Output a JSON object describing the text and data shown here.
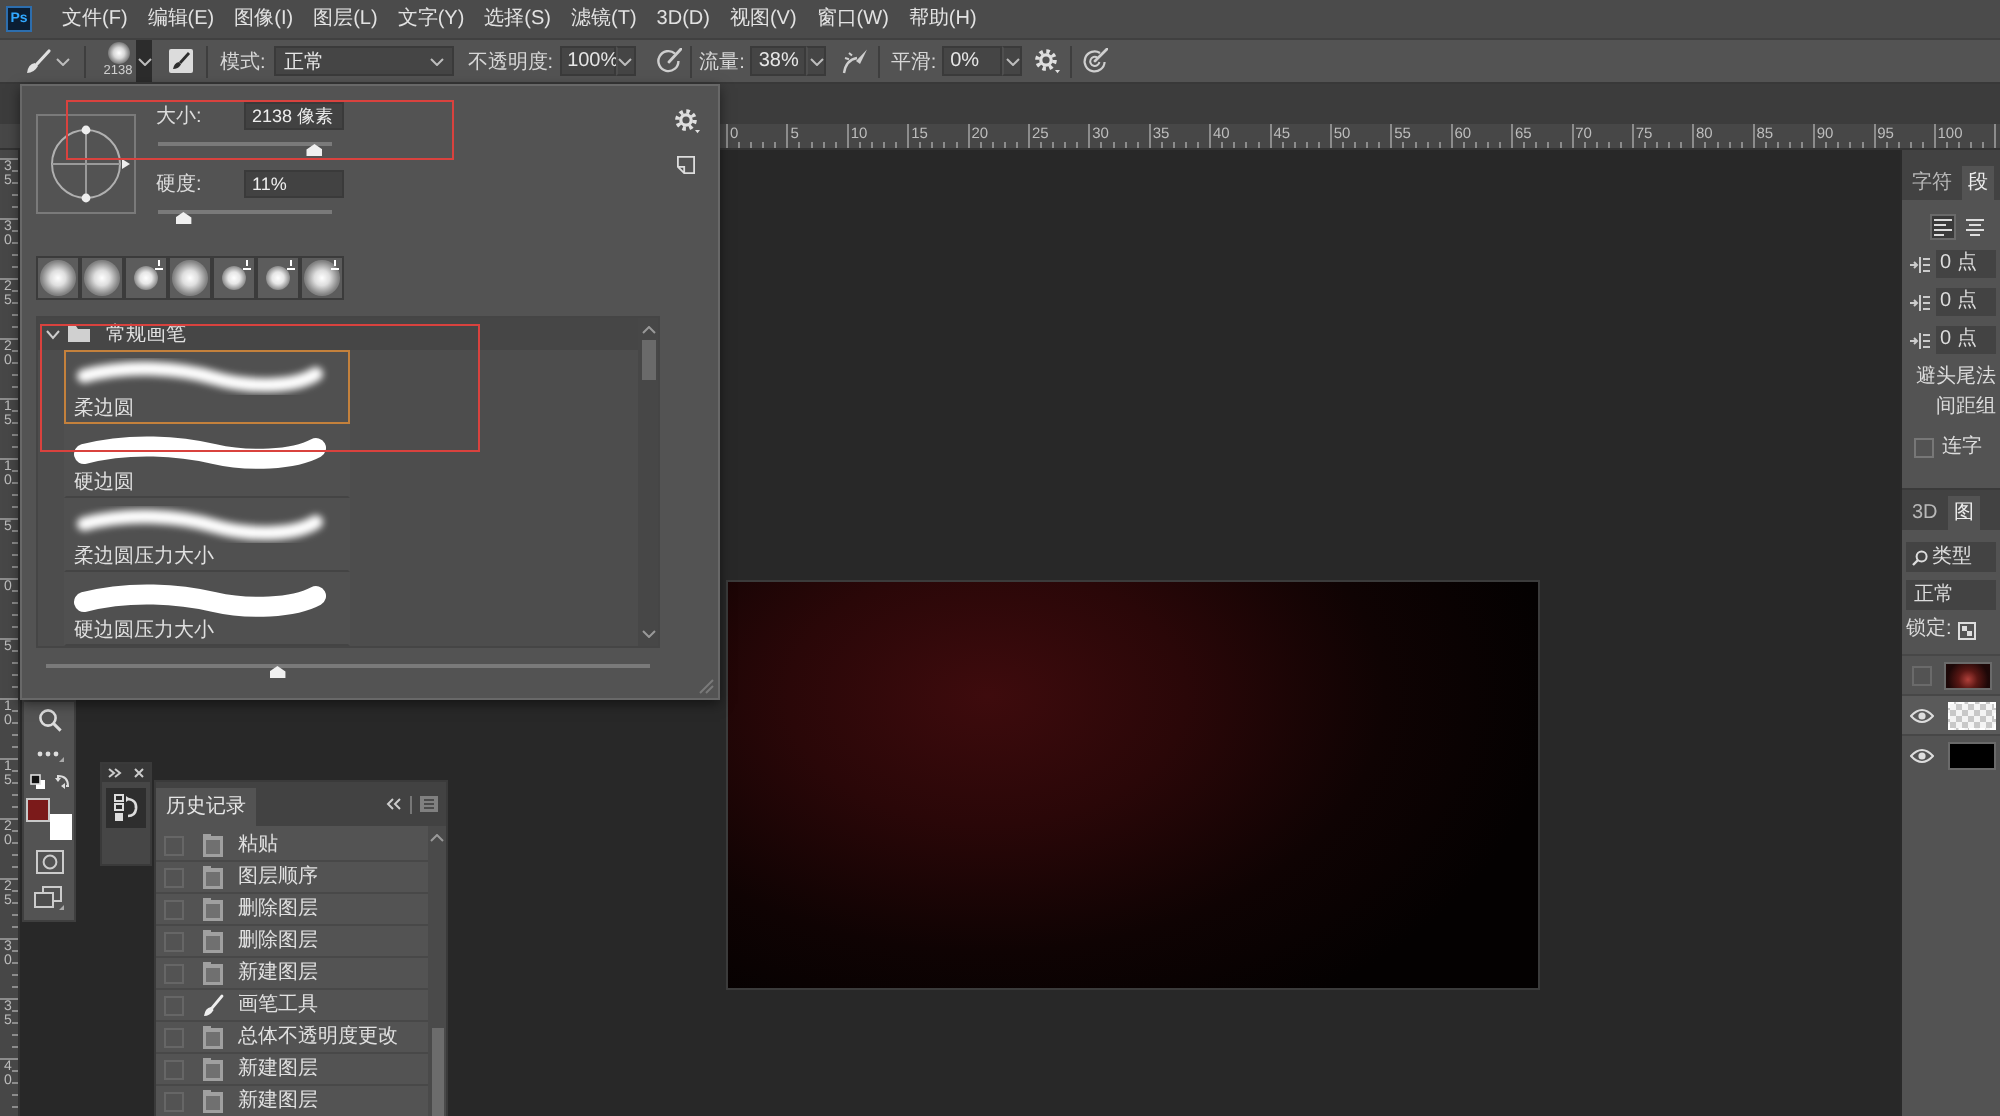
{
  "app": {
    "logo": "Ps"
  },
  "menu_bar": {
    "items": [
      "文件(F)",
      "编辑(E)",
      "图像(I)",
      "图层(L)",
      "文字(Y)",
      "选择(S)",
      "滤镜(T)",
      "3D(D)",
      "视图(V)",
      "窗口(W)",
      "帮助(H)"
    ]
  },
  "options_bar": {
    "brush_size": "2138",
    "mode_label": "模式:",
    "mode": "正常",
    "opacity_label": "不透明度:",
    "opacity": "100%",
    "flow_label": "流量:",
    "flow": "38%",
    "smoothing_label": "平滑:",
    "smoothing": "0%"
  },
  "rulers": {
    "horizontal": [
      "0",
      "5",
      "10",
      "15",
      "20",
      "25",
      "30",
      "35",
      "40",
      "45",
      "50",
      "55",
      "60",
      "65",
      "70",
      "75",
      "80",
      "85",
      "90",
      "95",
      "100"
    ],
    "vertical": [
      "35",
      "30",
      "25",
      "20",
      "15",
      "10",
      "5",
      "0",
      "5",
      "10",
      "15",
      "20",
      "25",
      "30",
      "35",
      "40"
    ]
  },
  "brush_panel": {
    "size_label": "大小:",
    "size": "2138 像素",
    "size_slider": {
      "level": 0.94
    },
    "size_highlighted": true,
    "hardness_label": "硬度:",
    "hardness": "11%",
    "hardness_slider": {
      "level": 0.11
    },
    "recent_brushes": [
      {
        "kind": "large",
        "pressure": false
      },
      {
        "kind": "large",
        "pressure": false
      },
      {
        "kind": "small",
        "pressure": true
      },
      {
        "kind": "large",
        "pressure": false
      },
      {
        "kind": "small",
        "pressure": true
      },
      {
        "kind": "small",
        "pressure": true
      },
      {
        "kind": "large",
        "pressure": true
      }
    ],
    "group": {
      "name": "常规画笔",
      "expanded": true,
      "highlighted": true,
      "brushes": [
        {
          "name": "柔边圆",
          "kind": "soft",
          "selected": true
        },
        {
          "name": "硬边圆",
          "kind": "hard",
          "selected": false
        },
        {
          "name": "柔边圆压力大小",
          "kind": "soft",
          "selected": false
        },
        {
          "name": "硬边圆压力大小",
          "kind": "hard",
          "selected": false
        }
      ]
    },
    "preview_slider": {
      "level": 0.38
    }
  },
  "toolbar": {
    "swatches": [
      {
        "kind": "foreground",
        "color": "#7b1a1a"
      },
      {
        "kind": "background",
        "color": "#ffffff"
      }
    ]
  },
  "history_panel": {
    "tab": "历史记录",
    "items": [
      {
        "text": "粘贴",
        "kind": "document",
        "checked": false
      },
      {
        "text": "图层顺序",
        "kind": "document",
        "checked": false
      },
      {
        "text": "删除图层",
        "kind": "document",
        "checked": false
      },
      {
        "text": "删除图层",
        "kind": "document",
        "checked": false
      },
      {
        "text": "新建图层",
        "kind": "document",
        "checked": false
      },
      {
        "text": "画笔工具",
        "kind": "brush",
        "checked": false
      },
      {
        "text": "总体不透明度更改",
        "kind": "document",
        "checked": false
      },
      {
        "text": "新建图层",
        "kind": "document",
        "checked": false
      },
      {
        "text": "新建图层",
        "kind": "document",
        "checked": false
      }
    ]
  },
  "paragraph_panel": {
    "tabs": [
      {
        "label": "字符",
        "selected": false
      },
      {
        "label": "段",
        "selected": true
      }
    ],
    "alignment": [
      {
        "kind": "left",
        "selected": true
      },
      {
        "kind": "center",
        "selected": false
      }
    ],
    "indents": [
      "0 点",
      "0 点",
      "0 点"
    ],
    "lines": [
      "避头尾法",
      "间距组"
    ],
    "hyphenate": {
      "label": "连字",
      "checked": false
    }
  },
  "layers_panel": {
    "tabs": [
      {
        "label": "3D",
        "selected": false
      },
      {
        "label": "图",
        "selected": true
      }
    ],
    "filter": "类型",
    "blend_mode": "正常",
    "lock_label": "锁定:",
    "layers": [
      {
        "kind": "photo",
        "visible": false,
        "selected": false
      },
      {
        "kind": "transparent",
        "visible": true,
        "selected": true
      },
      {
        "kind": "black",
        "visible": true,
        "selected": false
      }
    ]
  }
}
